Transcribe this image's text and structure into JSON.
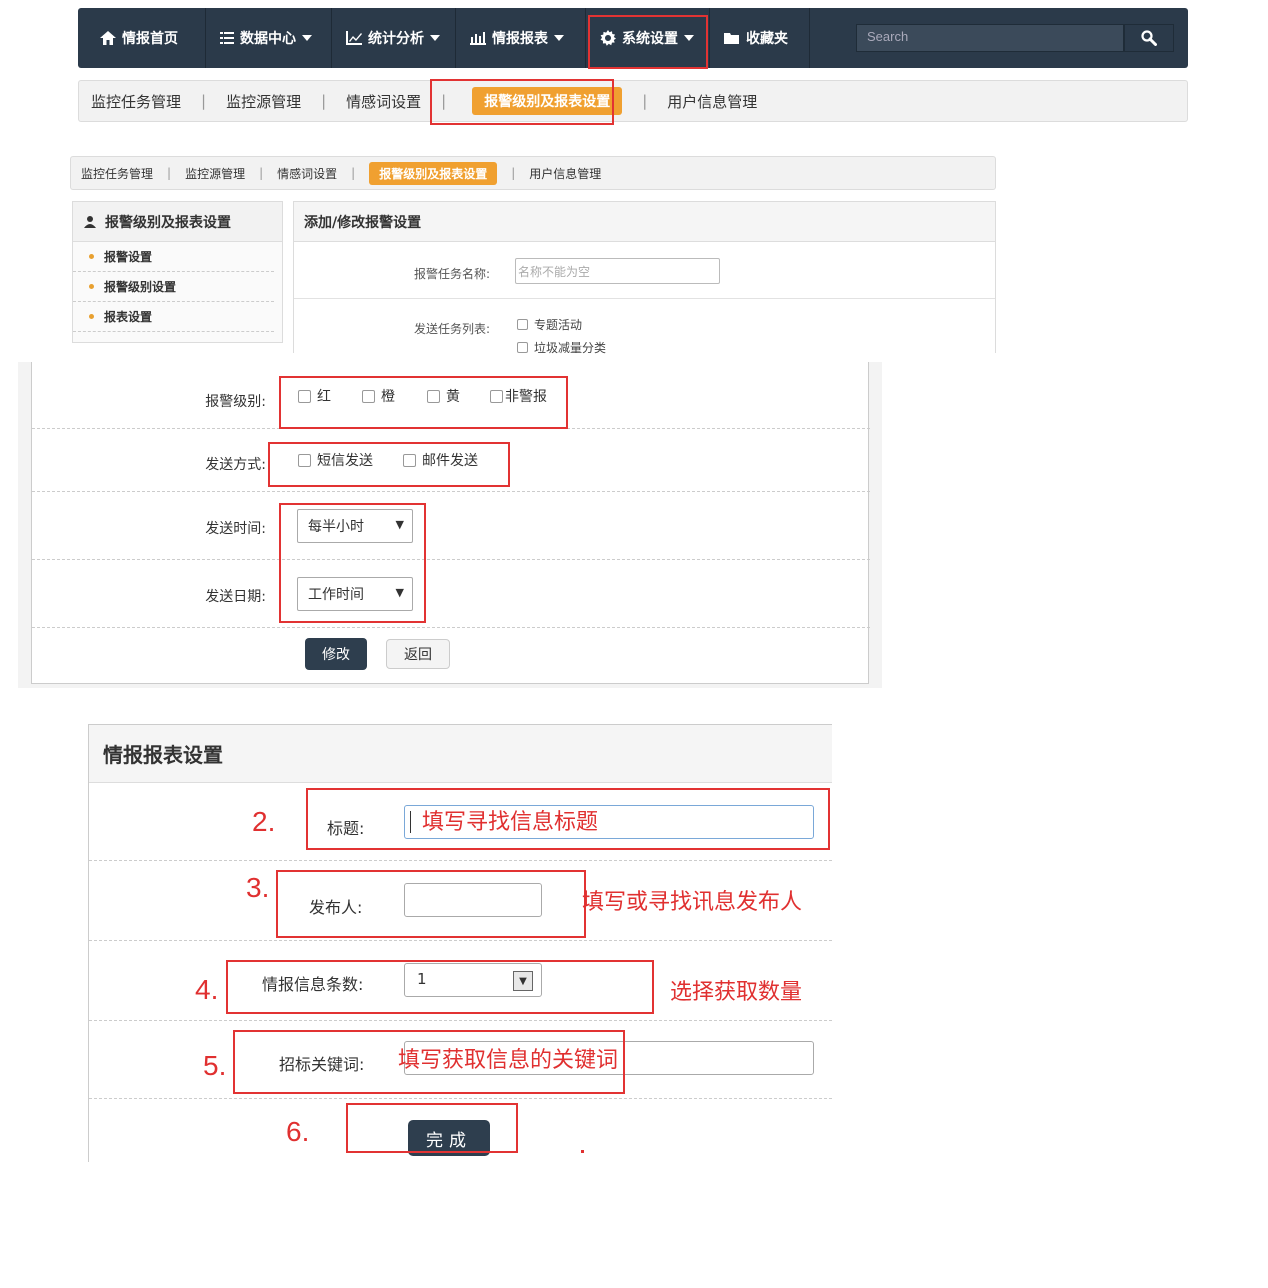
{
  "navbar": {
    "items": [
      {
        "label": "情报首页",
        "icon": "home-icon"
      },
      {
        "label": "数据中心",
        "icon": "list-icon",
        "dropdown": true
      },
      {
        "label": "统计分析",
        "icon": "line-chart-icon",
        "dropdown": true
      },
      {
        "label": "情报报表",
        "icon": "bar-chart-icon",
        "dropdown": true
      },
      {
        "label": "系统设置",
        "icon": "gear-icon",
        "dropdown": true
      },
      {
        "label": "收藏夹",
        "icon": "folder-icon"
      }
    ],
    "search_placeholder": "Search"
  },
  "subnav": {
    "items": [
      "监控任务管理",
      "监控源管理",
      "情感词设置",
      "报警级别及报表设置",
      "用户信息管理"
    ],
    "active": "报警级别及报表设置"
  },
  "panel2": {
    "sidebar_title": "报警级别及报表设置",
    "sidebar_items": [
      "报警设置",
      "报警级别设置",
      "报表设置"
    ],
    "main_title": "添加/修改报警设置",
    "task_name_label": "报警任务名称:",
    "task_name_placeholder": "名称不能为空",
    "task_list_label": "发送任务列表:",
    "task_list_options": [
      "专题活动",
      "垃圾减量分类"
    ]
  },
  "panel3": {
    "alarm_level_label": "报警级别:",
    "alarm_levels": [
      "红",
      "橙",
      "黄",
      "非警报"
    ],
    "send_method_label": "发送方式:",
    "send_methods": [
      "短信发送",
      "邮件发送"
    ],
    "send_time_label": "发送时间:",
    "send_time_value": "每半小时",
    "send_date_label": "发送日期:",
    "send_date_value": "工作时间",
    "modify_button": "修改",
    "back_button": "返回"
  },
  "panel4": {
    "title": "情报报表设置",
    "title_field": {
      "step": "2.",
      "label": "标题:",
      "hint": "填写寻找信息标题"
    },
    "publisher_field": {
      "step": "3.",
      "label": "发布人:",
      "hint": "填写或寻找讯息发布人"
    },
    "count_field": {
      "step": "4.",
      "label": "情报信息条数:",
      "value": "1",
      "hint": "选择获取数量"
    },
    "keyword_field": {
      "step": "5.",
      "label": "招标关键词:",
      "hint": "填写获取信息的关键词"
    },
    "done": {
      "step": "6.",
      "label": "完成"
    }
  },
  "colors": {
    "navbar": "#2b3a4a",
    "active_tab": "#f0a030",
    "annotation": "#e23333"
  }
}
